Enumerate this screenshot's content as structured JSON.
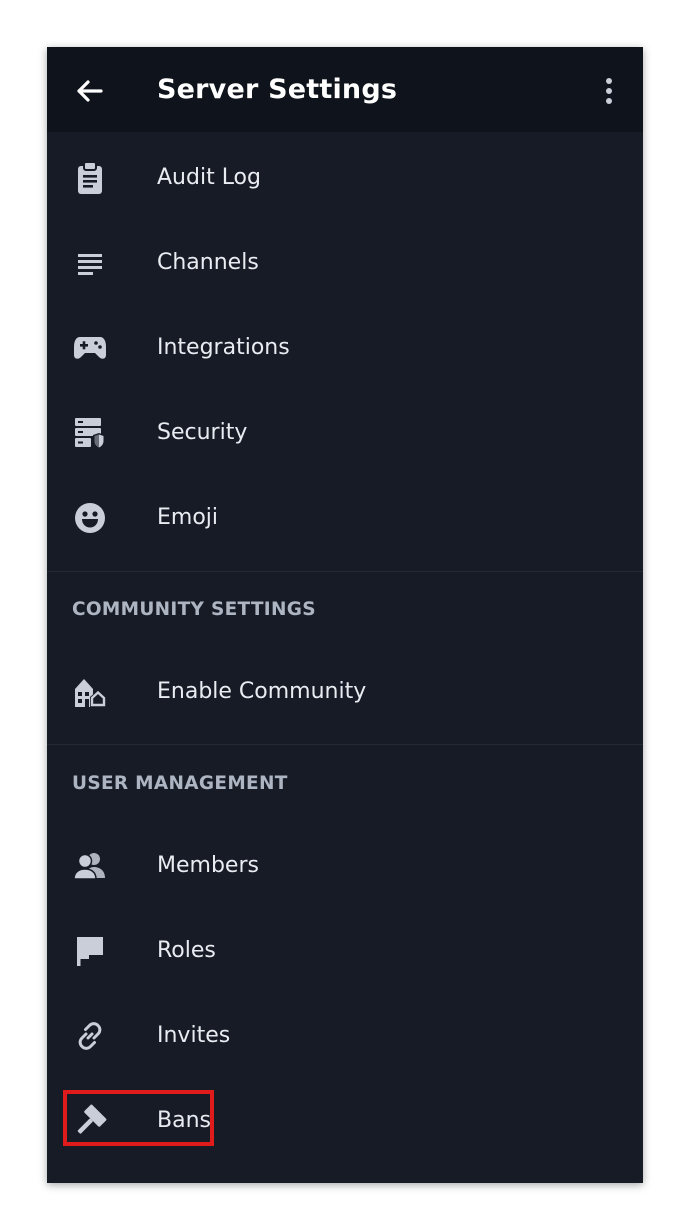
{
  "header": {
    "title": "Server Settings",
    "back_icon": "arrow-left-icon",
    "more_icon": "more-vertical-icon"
  },
  "settings_items": [
    {
      "label": "Audit Log",
      "icon": "clipboard-icon"
    },
    {
      "label": "Channels",
      "icon": "list-lines-icon"
    },
    {
      "label": "Integrations",
      "icon": "gamepad-icon"
    },
    {
      "label": "Security",
      "icon": "server-shield-icon"
    },
    {
      "label": "Emoji",
      "icon": "smiley-icon"
    }
  ],
  "community": {
    "header": "COMMUNITY SETTINGS",
    "items": [
      {
        "label": "Enable Community",
        "icon": "community-houses-icon"
      }
    ]
  },
  "user_management": {
    "header": "USER MANAGEMENT",
    "items": [
      {
        "label": "Members",
        "icon": "people-icon"
      },
      {
        "label": "Roles",
        "icon": "flag-icon"
      },
      {
        "label": "Invites",
        "icon": "link-icon"
      },
      {
        "label": "Bans",
        "icon": "hammer-icon"
      }
    ]
  },
  "colors": {
    "background": "#161b26",
    "topbar": "#0f131b",
    "text": "#e9ecf1",
    "section_header": "#aeb5c2",
    "icon": "#c9ced8",
    "highlight": "#e01b1b"
  }
}
